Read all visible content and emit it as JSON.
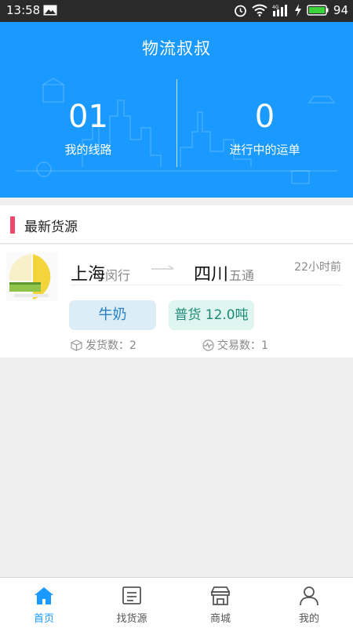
{
  "status_bar": {
    "time": "13:58",
    "battery": "94"
  },
  "header": {
    "title": "物流叔叔",
    "stats": [
      {
        "value": "01",
        "label": "我的线路"
      },
      {
        "value": "0",
        "label": "进行中的运单"
      }
    ]
  },
  "section": {
    "title": "最新货源"
  },
  "listing": {
    "from_city": "上海",
    "from_district": "闵行",
    "to_city": "四川",
    "to_district": "五通",
    "time_ago": "22小时前",
    "tag_goods": "牛奶",
    "tag_type": "普货 12.0吨",
    "shipments_label": "发货数：2",
    "transactions_label": "交易数：1"
  },
  "tabs": [
    {
      "label": "首页",
      "icon": "home-icon",
      "active": true
    },
    {
      "label": "找货源",
      "icon": "list-icon",
      "active": false
    },
    {
      "label": "商城",
      "icon": "store-icon",
      "active": false
    },
    {
      "label": "我的",
      "icon": "user-icon",
      "active": false
    }
  ],
  "colors": {
    "primary": "#1a9aff",
    "accent_bar": "#f0456d",
    "tag_goods_bg": "#dcedf8",
    "tag_type_bg": "#dff5ef"
  }
}
